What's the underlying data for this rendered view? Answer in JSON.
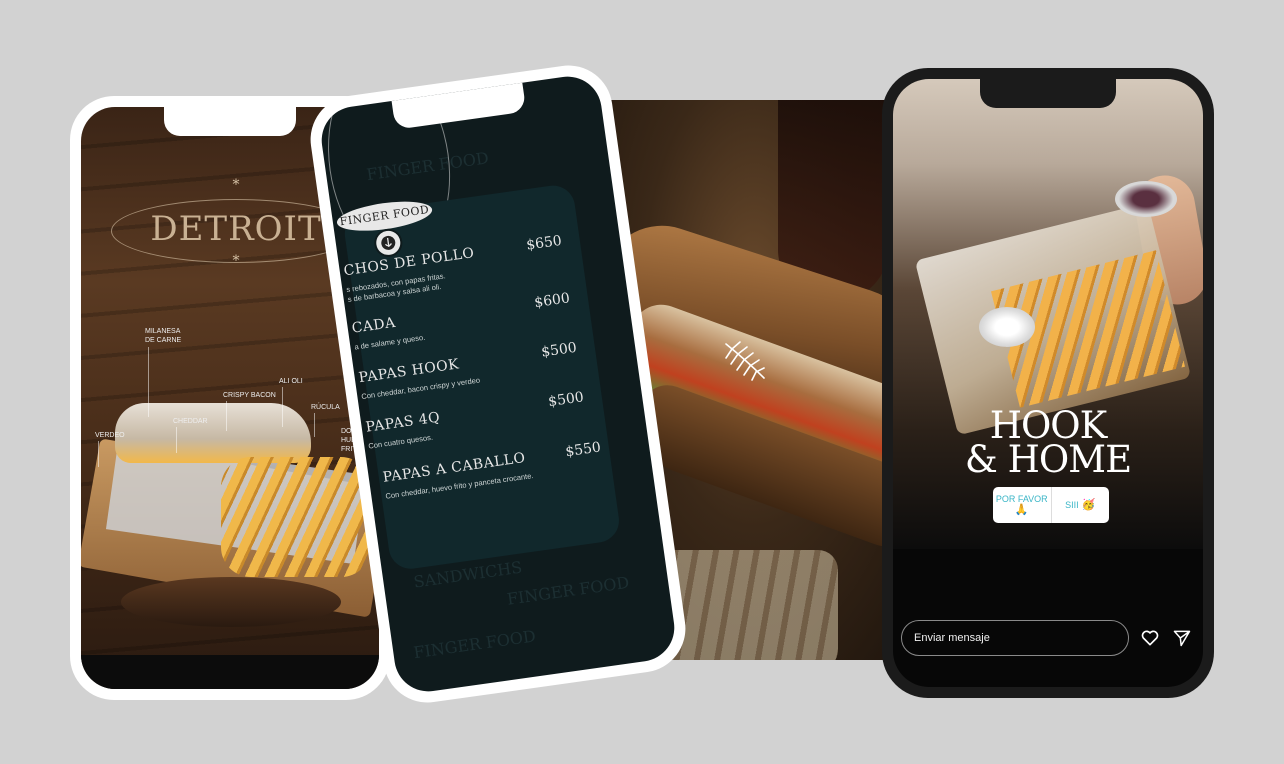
{
  "phone1": {
    "title": "DETROIT",
    "star": "*",
    "ingredients": {
      "milanesa": "MILANESA DE CARNE",
      "crispy_bacon": "CRISPY BACON",
      "ali_oli": "ALI OLI",
      "cheddar": "CHEDDAR",
      "rucula": "RÚCULA",
      "verdeo": "VERDEO",
      "doble_huevo": "DOBLE HUEVO FRITO"
    }
  },
  "phone2": {
    "section_label": "FINGER FOOD",
    "pattern_words": [
      "FINGER FOOD",
      "SANDWICHS"
    ],
    "items": [
      {
        "name": "CHOS DE POLLO",
        "price": "$650",
        "desc": "s rebozados, con papas fritas.\ns de barbacoa y salsa ali oli."
      },
      {
        "name": "CADA",
        "price": "$600",
        "desc": "a de salame y queso."
      },
      {
        "name": "PAPAS HOOK",
        "price": "$500",
        "desc": "Con cheddar, bacon crispy y verdeo"
      },
      {
        "name": "PAPAS 4Q",
        "price": "$500",
        "desc": "Con cuatro quesos."
      },
      {
        "name": "PAPAS A CABALLO",
        "price": "$550",
        "desc": "Con cheddar, huevo frito y panceta crocante."
      }
    ]
  },
  "phone3": {
    "title_line1": "HOOK",
    "title_line2": "& HOME",
    "poll": {
      "option1": "POR FAVOR",
      "option1_emoji": "🙏",
      "option2": "SIII",
      "option2_emoji": "🥳"
    },
    "message_placeholder": "Enviar mensaje"
  }
}
